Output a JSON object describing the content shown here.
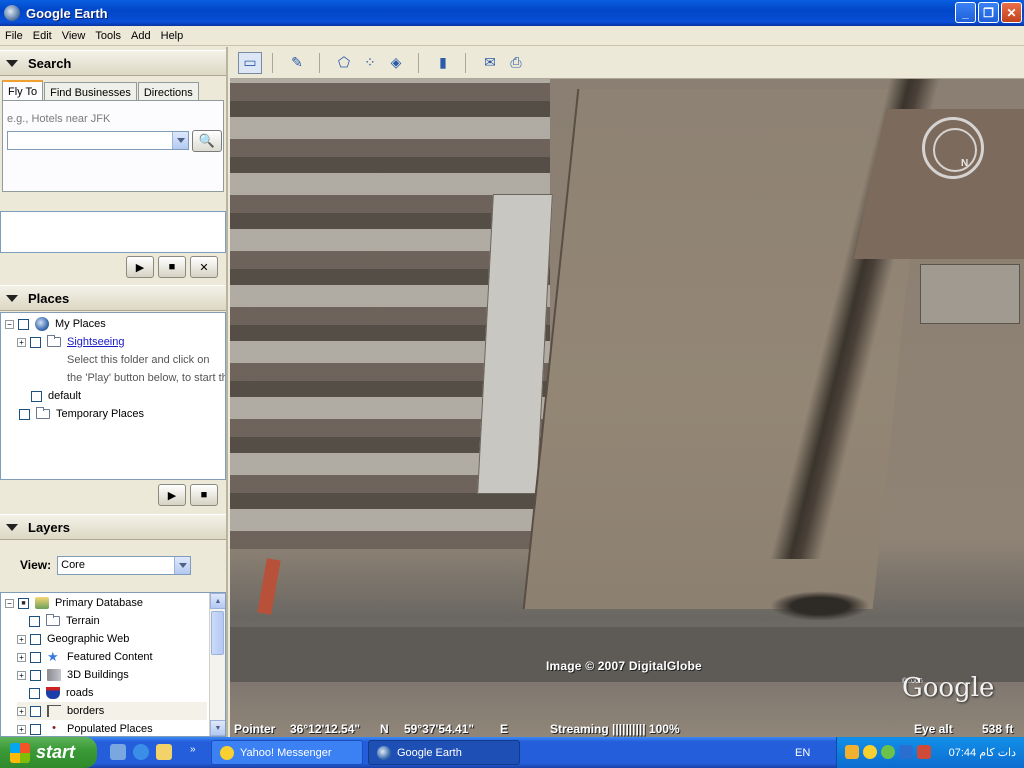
{
  "window": {
    "title": "Google Earth"
  },
  "menu": [
    "File",
    "Edit",
    "View",
    "Tools",
    "Add",
    "Help"
  ],
  "search": {
    "header": "Search",
    "tabs": [
      "Fly To",
      "Find Businesses",
      "Directions"
    ],
    "hint": "e.g., Hotels near JFK",
    "input_value": ""
  },
  "places": {
    "header": "Places",
    "items": [
      {
        "label": "My Places",
        "icon": "globe-icon"
      },
      {
        "label": "Sightseeing",
        "icon": "folder-icon"
      },
      {
        "label": "Select this folder and click on"
      },
      {
        "label": "the 'Play' button below, to start th"
      },
      {
        "label": "default"
      },
      {
        "label": "Temporary Places",
        "icon": "folder-icon"
      }
    ]
  },
  "layers": {
    "header": "Layers",
    "view_label": "View:",
    "view_value": "Core",
    "items": [
      {
        "label": "Primary Database",
        "icon": "layers-icon"
      },
      {
        "label": "Terrain",
        "icon": "folder-icon"
      },
      {
        "label": "Geographic Web"
      },
      {
        "label": "Featured Content",
        "icon": "star-icon"
      },
      {
        "label": "3D Buildings",
        "icon": "building-icon"
      },
      {
        "label": "roads",
        "icon": "road-shield-icon"
      },
      {
        "label": "borders",
        "icon": "flag-icon"
      },
      {
        "label": "Populated Places",
        "icon": "dot-icon"
      }
    ]
  },
  "map": {
    "copyright": "Image © 2007 DigitalGlobe",
    "logo": "Google",
    "logo_year": "©2006",
    "compass_label": "N",
    "status": {
      "pointer_label": "Pointer",
      "lat": "36°12'12.54\"",
      "lat_dir": "N",
      "lon": "59°37'54.41\"",
      "lon_dir": "E",
      "streaming": "Streaming |||||||||| 100%",
      "eye_alt_label": "Eye alt",
      "eye_alt": "538 ft"
    }
  },
  "taskbar": {
    "start": "start",
    "tasks": [
      "Yahoo! Messenger",
      "Google Earth"
    ],
    "lang": "EN",
    "clock": "07:44 دات کام"
  }
}
